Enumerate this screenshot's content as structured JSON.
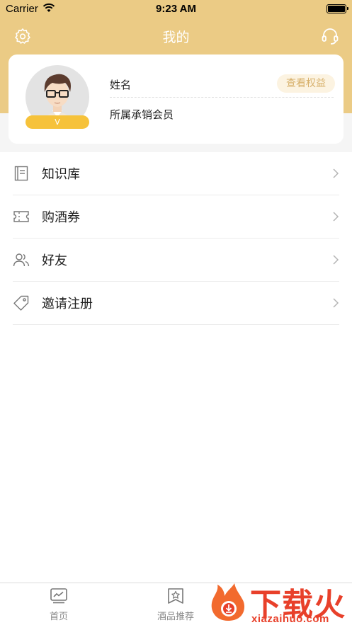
{
  "status_bar": {
    "carrier": "Carrier",
    "time": "9:23 AM"
  },
  "nav": {
    "title": "我的"
  },
  "profile": {
    "name": "姓名",
    "member_label": "所属承销会员",
    "rights_button": "查看权益",
    "vip_badge": "V"
  },
  "menu": {
    "items": [
      {
        "label": "知识库",
        "icon": "book-icon"
      },
      {
        "label": "购酒券",
        "icon": "ticket-icon"
      },
      {
        "label": "好友",
        "icon": "friends-icon"
      },
      {
        "label": "邀请注册",
        "icon": "tag-icon"
      }
    ]
  },
  "tab_bar": {
    "tabs": [
      {
        "label": "首页",
        "icon": "chart-board-icon"
      },
      {
        "label": "酒品推荐",
        "icon": "star-bookmark-icon"
      }
    ]
  },
  "watermark": {
    "brand": "下载火",
    "domain": "xiazaihuo.com"
  },
  "colors": {
    "header_yellow": "#ebcb85",
    "accent_gold": "#d7b06b",
    "vip_yellow": "#f6c23a",
    "watermark_red": "#e8402a"
  }
}
